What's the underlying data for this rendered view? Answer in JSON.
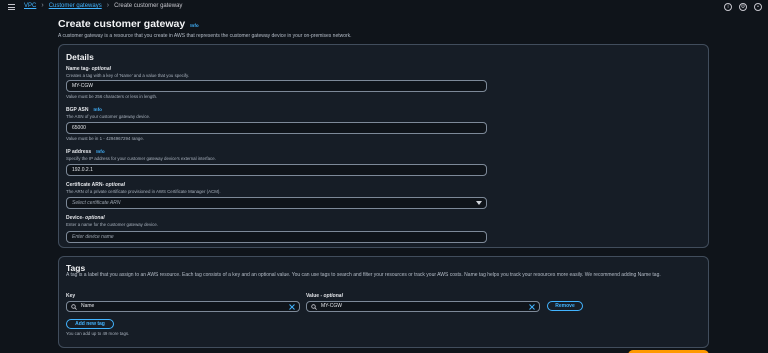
{
  "breadcrumb": {
    "root": "VPC",
    "parent": "Customer gateways",
    "current": "Create customer gateway"
  },
  "page": {
    "title": "Create customer gateway",
    "info": "Info",
    "description": "A customer gateway is a resource that you create in AWS that represents the customer gateway device in your on-premises network."
  },
  "details": {
    "title": "Details",
    "name_tag": {
      "label": "Name tag",
      "optional": " - optional",
      "description": "Creates a tag with a key of 'Name' and a value that you specify.",
      "value": "MY-CGW",
      "hint": "Value must be 256 characters or less in length."
    },
    "bgp_asn": {
      "label": "BGP ASN",
      "info": "Info",
      "description": "The ASN of your customer gateway device.",
      "value": "65000",
      "hint": "Value must be in 1 - 4294967294 range."
    },
    "ip_address": {
      "label": "IP address",
      "info": "Info",
      "description": "Specify the IP address for your customer gateway device's external interface.",
      "value": "192.0.2.1"
    },
    "certificate_arn": {
      "label": "Certificate ARN",
      "optional": " - optional",
      "description": "The ARN of a private certificate provisioned in AWS Certificate Manager (ACM).",
      "placeholder": "Select certificate ARN"
    },
    "device": {
      "label": "Device",
      "optional": " - optional",
      "description": "Enter a name for the customer gateway device.",
      "placeholder": "Enter device name"
    }
  },
  "tags": {
    "title": "Tags",
    "description": "A tag is a label that you assign to an AWS resource. Each tag consists of a key and an optional value. You can use tags to search and filter your resources or track your AWS costs. Name tag helps you track your resources more easily. We recommend adding Name tag.",
    "key_label": "Key",
    "value_label": "Value",
    "value_optional": " - optional",
    "key_value": "Name",
    "value_value": "MY-CGW",
    "remove_label": "Remove",
    "add_label": "Add new tag",
    "hint": "You can add up to 49 more tags."
  },
  "icons": [
    "menu-icon",
    "chevron-right-icon",
    "info-circle-icon",
    "settings-gear-icon",
    "notification-icon",
    "search-icon",
    "clear-x-icon",
    "caret-down-icon"
  ],
  "colors": {
    "background": "#0f141a",
    "panel": "#161d26",
    "link": "#42b4ff",
    "primary": "#ff9900",
    "border": "#414d5c"
  }
}
